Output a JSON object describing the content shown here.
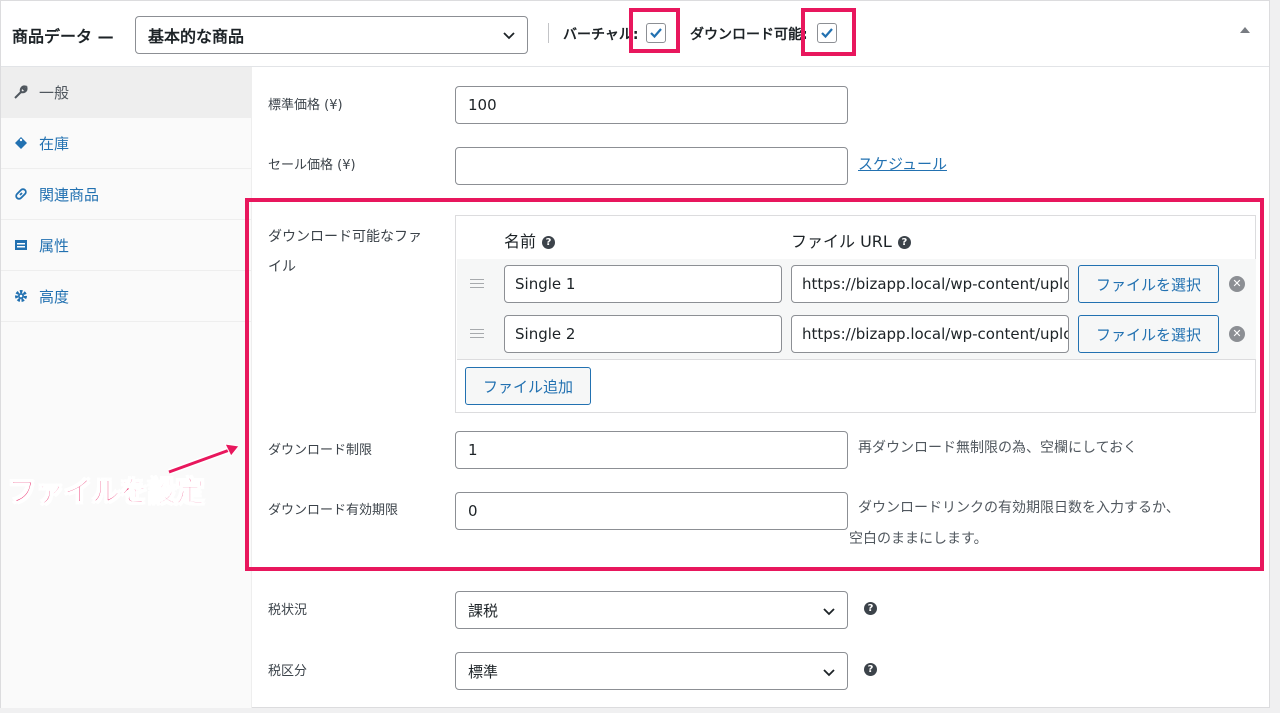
{
  "header": {
    "title": "商品データ —",
    "product_type": "基本的な商品",
    "virtual_label": "バーチャル:",
    "virtual_checked": true,
    "downloadable_label": "ダウンロード可能:",
    "downloadable_checked": true
  },
  "sidebar": {
    "items": [
      {
        "label": "一般",
        "icon": "wrench-icon",
        "active": true
      },
      {
        "label": "在庫",
        "icon": "tag-icon",
        "active": false
      },
      {
        "label": "関連商品",
        "icon": "link-icon",
        "active": false
      },
      {
        "label": "属性",
        "icon": "list-icon",
        "active": false
      },
      {
        "label": "高度",
        "icon": "gear-icon",
        "active": false
      }
    ]
  },
  "general": {
    "regular_price_label": "標準価格 (¥)",
    "regular_price": "100",
    "sale_price_label": "セール価格 (¥)",
    "sale_price": "",
    "schedule_link": "スケジュール",
    "downloadable_files_label_line1": "ダウンロード可能なファ",
    "downloadable_files_label_line2": "イル",
    "files_header_name": "名前",
    "files_header_url": "ファイル URL",
    "files": [
      {
        "name": "Single 1",
        "url": "https://bizapp.local/wp-content/uploads/"
      },
      {
        "name": "Single 2",
        "url": "https://bizapp.local/wp-content/uploads/"
      }
    ],
    "choose_file_button": "ファイルを選択",
    "add_file_button": "ファイル追加",
    "download_limit_label": "ダウンロード制限",
    "download_limit": "1",
    "download_limit_desc": "再ダウンロード無制限の為、空欄にしておく",
    "download_expiry_label": "ダウンロード有効期限",
    "download_expiry": "0",
    "download_expiry_desc_line1": "ダウンロードリンクの有効期限日数を入力するか、",
    "download_expiry_desc_line2": "空白のままにします。",
    "tax_status_label": "税状況",
    "tax_status": "課税",
    "tax_class_label": "税区分",
    "tax_class": "標準"
  },
  "annotation": {
    "text": "ファイルを設定",
    "color": "#e8175d"
  }
}
